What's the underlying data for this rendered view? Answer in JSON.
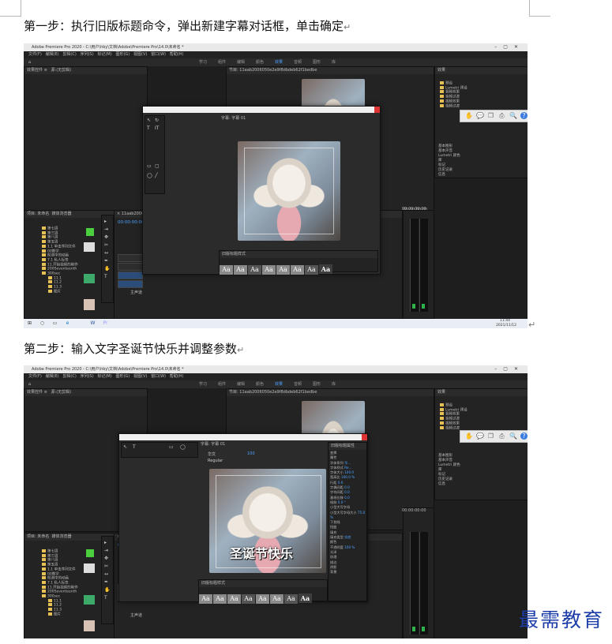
{
  "document": {
    "step1": "第一步：执行旧版标题命令，弹出新建字幕对话框，单击确定",
    "step2": "第二步：输入文字圣诞节快乐并调整参数",
    "return_mark": "↵",
    "watermark": "最需教育"
  },
  "shot1": {
    "window_title": "Adobe Premiere Pro 2020 - C:\\用户\\hby\\文档\\Adobe\\Premiere Pro\\14.0\\未命名 *",
    "menu": [
      "文件(F)",
      "编辑(E)",
      "剪辑(C)",
      "序列(S)",
      "标记(M)",
      "图形(G)",
      "视图(V)",
      "窗口(W)",
      "帮助(H)"
    ],
    "workspaces": [
      "学习",
      "组件",
      "编辑",
      "颜色",
      "效果",
      "音频",
      "图形",
      "库"
    ],
    "active_workspace": "效果",
    "program_monitor_title": "节目: 11aab2006050e2e9f8dbdeb62f1bedbe",
    "effects_panel_title": "效果",
    "effects_tree": [
      "预设",
      "Lumetri 预设",
      "音频效果",
      "音频过渡",
      "视频效果",
      "视频过渡"
    ],
    "effects_side_items": [
      "基本图形",
      "基本声音",
      "Lumetri 颜色",
      "库",
      "标记",
      "历史记录",
      "信息"
    ],
    "project_panel_title": "项目: 未命名",
    "media_browser_title": "媒体浏览器",
    "tree_items": [
      "第七周",
      "第三周",
      "第八周",
      "第五周",
      "1.1 单击序列文件",
      "00教学",
      "检测中的动画",
      "7.1 私人标签",
      "11.开始视频的制作",
      "200Seventeenth",
      "300sec",
      "11.1",
      "11.2",
      "11.3",
      "图片"
    ],
    "timeline_timecode": "00:00:00:00",
    "dialog_title": "字幕: 字幕 01",
    "styles_title": "旧版标题样式",
    "styles": [
      "Aa",
      "Aa",
      "Aa",
      "Aa",
      "Aa",
      "Aa",
      "Aa",
      "Aa"
    ],
    "monitor_timecode": "00:00:00:00",
    "audio_label": "主声道",
    "tray_time": "11:44",
    "tray_date": "2021/11/12"
  },
  "shot2": {
    "window_title": "Adobe Premiere Pro 2020 - C:\\用户\\hby\\文档\\Adobe\\Premiere Pro\\14.0\\未命名 *",
    "menu": [
      "文件(F)",
      "编辑(E)",
      "剪辑(C)",
      "序列(S)",
      "标记(M)",
      "图形(G)",
      "视图(V)",
      "窗口(W)",
      "帮助(H)"
    ],
    "workspaces": [
      "学习",
      "组件",
      "编辑",
      "颜色",
      "效果",
      "音频",
      "图形",
      "库"
    ],
    "active_workspace": "效果",
    "program_monitor_title": "节目: 11aab2006050e2e9f8dbdeb62f1bedbe",
    "dialog_title": "字幕: 字幕 01",
    "font_name": "华文",
    "font_style": "Regular",
    "font_size": "100",
    "subtitle_text": "圣诞节快乐",
    "properties_title": "旧版标题属性",
    "properties": [
      {
        "label": "变换",
        "value": ""
      },
      {
        "label": "属性",
        "value": ""
      },
      {
        "label": "字体系列",
        "value": "华..."
      },
      {
        "label": "字体样式",
        "value": "Re..."
      },
      {
        "label": "字体大小",
        "value": "100.0"
      },
      {
        "label": "宽高比",
        "value": "100.0 %"
      },
      {
        "label": "行距",
        "value": "0.0"
      },
      {
        "label": "字偶间距",
        "value": "0.0"
      },
      {
        "label": "字符间距",
        "value": "0.0"
      },
      {
        "label": "基线位移",
        "value": "0.0"
      },
      {
        "label": "倾斜",
        "value": "0.0 °"
      },
      {
        "label": "小型大写字母",
        "value": ""
      },
      {
        "label": "小型大写字母大小",
        "value": "75.0 %"
      },
      {
        "label": "下划线",
        "value": ""
      },
      {
        "label": "扭曲",
        "value": ""
      },
      {
        "label": "填充",
        "value": ""
      },
      {
        "label": "填充类型",
        "value": "实底"
      },
      {
        "label": "颜色",
        "value": ""
      },
      {
        "label": "不透明度",
        "value": "100 %"
      },
      {
        "label": "光泽",
        "value": ""
      },
      {
        "label": "纹理",
        "value": ""
      },
      {
        "label": "描边",
        "value": ""
      },
      {
        "label": "阴影",
        "value": ""
      },
      {
        "label": "背景",
        "value": ""
      }
    ],
    "styles_title": "旧版标题样式",
    "styles": [
      "Aa",
      "Aa",
      "Aa",
      "Aa",
      "Aa",
      "Aa",
      "Aa",
      "Aa"
    ],
    "effects_side_items": [
      "基本图形",
      "基本声音",
      "Lumetri 颜色",
      "库",
      "标记",
      "历史记录",
      "信息"
    ],
    "effects_tree": [
      "预设",
      "Lumetri 预设",
      "音频效果",
      "音频过渡",
      "视频效果",
      "视频过渡"
    ],
    "tree_items": [
      "第七周",
      "第三周",
      "第八周",
      "第五周",
      "1.1 单击序列文件",
      "00教学",
      "检测中的动画",
      "7.1 私人标签",
      "11.开始视频的制作",
      "200Seventeenth",
      "300sec",
      "11.1",
      "11.2",
      "11.3",
      "图片"
    ],
    "timeline_timecode": "00:00:00:00",
    "audio_label": "主声道"
  },
  "colors": {
    "accent": "#4da3ff",
    "green_meter": "#2fb24a",
    "watermark": "#1d3ea8"
  }
}
